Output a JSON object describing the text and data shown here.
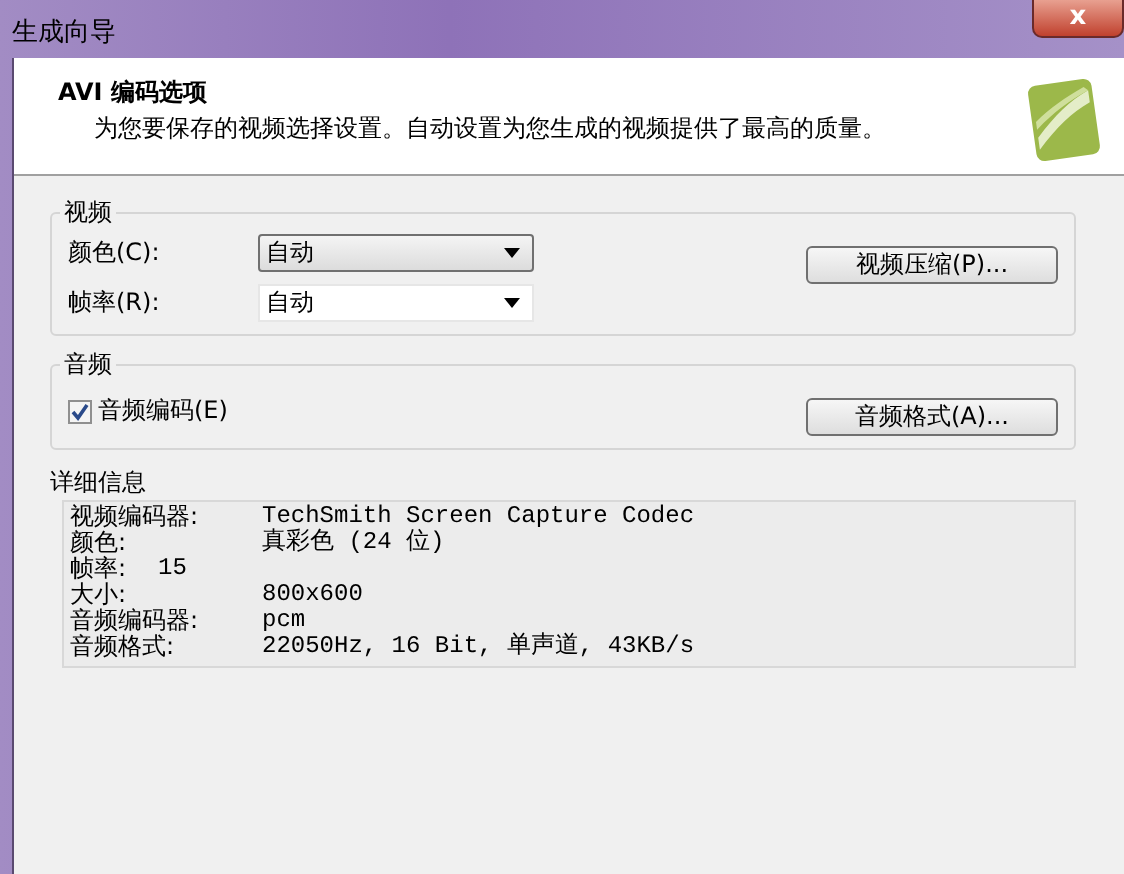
{
  "window": {
    "title": "生成向导",
    "close": "x"
  },
  "header": {
    "title": "AVI 编码选项",
    "subtitle": "为您要保存的视频选择设置。自动设置为您生成的视频提供了最高的质量。"
  },
  "video": {
    "legend": "视频",
    "fields": [
      {
        "label": "颜色(C):",
        "value": "自动",
        "focused": true
      },
      {
        "label": "帧率(R):",
        "value": "自动",
        "focused": false
      }
    ],
    "button": "视频压缩(P)..."
  },
  "audio": {
    "legend": "音频",
    "checkbox": {
      "label": "音频编码(E)",
      "checked": true
    },
    "button": "音频格式(A)..."
  },
  "details": {
    "legend": "详细信息",
    "rows": [
      {
        "label": "视频编码器:",
        "value": "TechSmith Screen Capture Codec",
        "kind": "column"
      },
      {
        "label": "颜色:",
        "value": "真彩色 (24 位)",
        "kind": "column"
      },
      {
        "label": "帧率:",
        "value": "15",
        "kind": "inline"
      },
      {
        "label": "大小:",
        "value": "800x600",
        "kind": "column"
      },
      {
        "label": "音频编码器:",
        "value": "pcm",
        "kind": "column"
      },
      {
        "label": "音频格式:",
        "value": "22050Hz, 16 Bit, 单声道, 43KB/s",
        "kind": "column"
      }
    ]
  }
}
